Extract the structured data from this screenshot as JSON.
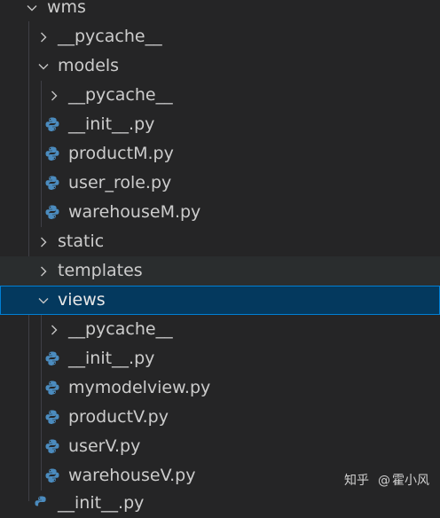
{
  "explorer": {
    "root": {
      "label": "wms",
      "expanded": true
    },
    "rows": [
      {
        "id": "pycache-root",
        "label": "__pycache__",
        "kind": "folder",
        "expanded": false
      },
      {
        "id": "models",
        "label": "models",
        "kind": "folder",
        "expanded": true
      },
      {
        "id": "models-pycache",
        "label": "__pycache__",
        "kind": "folder",
        "expanded": false
      },
      {
        "id": "models-init",
        "label": "__init__.py",
        "kind": "python-file"
      },
      {
        "id": "productM",
        "label": "productM.py",
        "kind": "python-file"
      },
      {
        "id": "user-role",
        "label": "user_role.py",
        "kind": "python-file"
      },
      {
        "id": "warehouseM",
        "label": "warehouseM.py",
        "kind": "python-file"
      },
      {
        "id": "static",
        "label": "static",
        "kind": "folder",
        "expanded": false
      },
      {
        "id": "templates",
        "label": "templates",
        "kind": "folder",
        "expanded": false,
        "hovered": true
      },
      {
        "id": "views",
        "label": "views",
        "kind": "folder",
        "expanded": true,
        "selected": true
      },
      {
        "id": "views-pycache",
        "label": "__pycache__",
        "kind": "folder",
        "expanded": false
      },
      {
        "id": "views-init",
        "label": "__init__.py",
        "kind": "python-file"
      },
      {
        "id": "mymodelview",
        "label": "mymodelview.py",
        "kind": "python-file"
      },
      {
        "id": "productV",
        "label": "productV.py",
        "kind": "python-file"
      },
      {
        "id": "userV",
        "label": "userV.py",
        "kind": "python-file"
      },
      {
        "id": "warehouseV",
        "label": "warehouseV.py",
        "kind": "python-file"
      }
    ],
    "partial_row": {
      "label": "__init__.py"
    }
  },
  "watermark": {
    "brand": "知乎",
    "at": "@",
    "author": "霍小风"
  },
  "colors": {
    "background": "#252526",
    "hover": "#2a2d2e",
    "selected": "#04395e",
    "focus_border": "#007fd4",
    "text": "#cccccc",
    "python_blue": "#4b8bbe",
    "python_yellow": "#ffd43b"
  }
}
